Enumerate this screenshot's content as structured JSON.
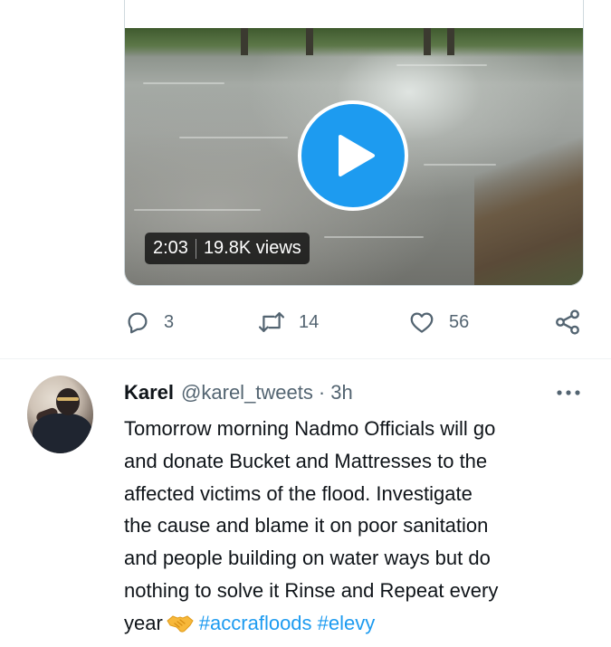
{
  "video_tweet": {
    "video": {
      "duration": "2:03",
      "views": "19.8K views"
    },
    "actions": {
      "reply_count": "3",
      "retweet_count": "14",
      "like_count": "56"
    },
    "icons": [
      "reply-icon",
      "retweet-icon",
      "like-icon",
      "share-icon",
      "play-icon"
    ]
  },
  "reply_tweet": {
    "display_name": "Karel",
    "handle": "@karel_tweets",
    "separator": "·",
    "time": "3h",
    "text_lines": [
      "Tomorrow morning Nadmo Officials will go",
      "and donate Bucket and Mattresses to the",
      "affected victims of the flood. Investigate",
      "the cause and blame it on poor sanitation",
      "and people building on water ways but do",
      "nothing to solve it Rinse and Repeat every"
    ],
    "last_line_word": "year",
    "emoji": "handshake",
    "hashtags": [
      "#accrafloods",
      "#elevy"
    ]
  },
  "colors": {
    "accent": "#1d9bf0",
    "text_primary": "#0f1419",
    "text_secondary": "#536471",
    "border": "#cfd9de"
  }
}
